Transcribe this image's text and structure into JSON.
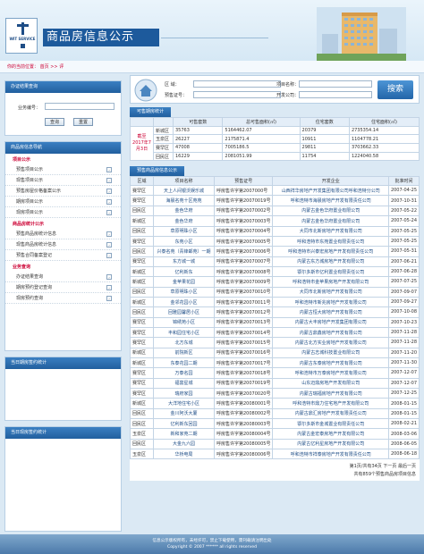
{
  "header": {
    "title": "商品房信息公示",
    "logo_text": "WIT SERVICE"
  },
  "breadcrumb": {
    "prefix": "你的当前位置：",
    "home": "首页",
    "sep1": ">>",
    "current": "评"
  },
  "left": {
    "cert_query": {
      "title": "办证结果查询",
      "label": "业务编号：",
      "query_btn": "查询",
      "reset_btn": "重置"
    },
    "info_nav": {
      "title": "商品房信息导航",
      "sections": [
        {
          "name": "项目公示",
          "items": [
            "预售项目公示",
            "现售项目公示",
            "预售房屋价格备案公示",
            "期房项目公示",
            "现房项目公示"
          ]
        },
        {
          "name": "商品房统计公示",
          "items": [
            "预售商品房统计信息",
            "现售商品房统计信息",
            "预售合同备案登记"
          ]
        },
        {
          "name": "业务查询",
          "items": [
            "办证结果查询",
            "期房预约登记查询",
            "现房预约查询"
          ]
        }
      ]
    },
    "today_contract": {
      "title": "当日期房签约统计"
    },
    "today_current": {
      "title": "当日现房签约统计"
    }
  },
  "search": {
    "district_label": "区   域：",
    "project_label": "项目名称：",
    "permit_label": "预售证号：",
    "developer_label": "开发公司：",
    "button": "搜索"
  },
  "stats": {
    "tab": "可售期房统计",
    "date_label": "截至2017年7月3日",
    "headers": [
      "",
      "可售套数",
      "总可售面积(㎡)",
      "住宅套数",
      "住宅面积(㎡)"
    ],
    "rows": [
      [
        "新城区",
        "35763",
        "5164462.07",
        "20379",
        "2735354.14"
      ],
      [
        "玉泉区",
        "26227",
        "2175871.4",
        "10911",
        "1104778.21"
      ],
      [
        "赛罕区",
        "47008",
        "7005186.5",
        "29811",
        "3703662.33"
      ],
      [
        "回民区",
        "16229",
        "2081051.99",
        "11754",
        "1224040.58"
      ]
    ]
  },
  "presale": {
    "tab": "预售商品房信息公示",
    "headers": [
      "区域",
      "项目名称",
      "预售证号",
      "开发企业",
      "批准时间"
    ],
    "rows": [
      [
        "赛罕区",
        "天上人间银沃娱乐城",
        "呼房售许字第2007000号",
        "山西祥华房地产开发集团有限公司呼和浩特分公司",
        "2007-04-25"
      ],
      [
        "赛罕区",
        "海晨名苑十区苑苑",
        "呼房售许字第20070019号",
        "呼和浩特市海晨房地产开发有限责任公司",
        "2007-10-31"
      ],
      [
        "回民区",
        "金色华府",
        "呼房售许字第20070002号",
        "内蒙古金色华府置业有限公司",
        "2007-05-22"
      ],
      [
        "新城区",
        "金色华府",
        "呼房售许字第20070003号",
        "内蒙古金色华府置业有限公司",
        "2007-05-24"
      ],
      [
        "回民区",
        "草原明珠小区",
        "呼房售许字第20070004号",
        "大同市北新房地产开发有限公司",
        "2007-05-25"
      ],
      [
        "赛罕区",
        "东苑小区",
        "呼房售许字第20070005号",
        "呼和浩特市东苑置业有限责任公司",
        "2007-05-25"
      ],
      [
        "回民区",
        "兴泰名苑（青锋邮苑）一期",
        "呼房售许字第20070006号",
        "呼和浩特市兴泰宏房地产开发有限责任公司",
        "2007-05-31"
      ],
      [
        "赛罕区",
        "东方城一城",
        "呼房售许字第20070007号",
        "内蒙古东方城房地产开发有限公司",
        "2007-06-21"
      ],
      [
        "新城区",
        "亿利新东",
        "呼房售许字第20070008号",
        "鄂尔多斯市亿利置业有限责任公司",
        "2007-06-28"
      ],
      [
        "新城区",
        "金苹果花园",
        "呼房售许字第20070009号",
        "呼和浩特市金苹果房地产开发有限公司",
        "2007-07-25"
      ],
      [
        "回民区",
        "草原明珠小区",
        "呼房售许字第20070010号",
        "大同市北新房地产开发有限公司",
        "2007-09-07"
      ],
      [
        "新城区",
        "金邻花园小区",
        "呼房售许字第20070011号",
        "呼和浩特市新兆房地产开发有限公司",
        "2007-09-27"
      ],
      [
        "回民区",
        "回雅园馨居小区",
        "呼房售许字第20070012号",
        "内蒙古恒大房地产开发有限公司",
        "2007-10-08"
      ],
      [
        "赛罕区",
        "锦绣苑小区",
        "呼房售许字第20070013号",
        "内蒙古大丰房地产开发集团有限公司",
        "2007-10-23"
      ],
      [
        "赛罕区",
        "丰和园住宅小区",
        "呼房售许字第20070014号",
        "内蒙古鼎鑫房地产开发有限公司",
        "2007-11-28"
      ],
      [
        "赛罕区",
        "北方东城",
        "呼房售许字第20070015号",
        "内蒙古北方实业房地产开发有限公司",
        "2007-11-28"
      ],
      [
        "新城区",
        "前院新区",
        "呼房售许字第20070016号",
        "内蒙古志城科技置业有限公司",
        "2007-11-20"
      ],
      [
        "新城区",
        "东泰花园二期",
        "呼房售许字第20070017号",
        "内蒙古东泰房地产开发有限公司",
        "2007-11-30"
      ],
      [
        "赛罕区",
        "万泰名园",
        "呼房售许字第20070018号",
        "呼和浩特市万泰房地产开发有限公司",
        "2007-12-07"
      ],
      [
        "赛罕区",
        "福富星城",
        "呼房售许字第20070019号",
        "山东迈鼎房地产开发有限公司",
        "2007-12-07"
      ],
      [
        "赛罕区",
        "瑞府家园",
        "呼房售许字第20070020号",
        "内蒙古瑞福房地产开发有限公司",
        "2007-12-25"
      ],
      [
        "新城区",
        "大洋地住宅小区",
        "呼房售许字第20080001号",
        "呼和浩特市鼎力住宅地产开发有限公司",
        "2008-01-15"
      ],
      [
        "回民区",
        "金川阿沃大厦",
        "呼房售许字第20080002号",
        "内蒙古鼎汇房地产开发有限责任公司",
        "2008-01-15"
      ],
      [
        "回民区",
        "亿利新东回园",
        "呼房售许字第20080003号",
        "鄂尔多斯市金城置业有限责任公司",
        "2008-02-21"
      ],
      [
        "玉泉区",
        "新和家苑二期",
        "呼房售许字第20080004号",
        "内蒙古金宏泰房地产开发有限公司",
        "2008-03-06"
      ],
      [
        "回民区",
        "大金九六园",
        "呼房售许字第20080005号",
        "内蒙古亿利星房地产开发有限公司",
        "2008-06-05"
      ],
      [
        "玉泉区",
        "华桥电局",
        "呼房售许字第20080006号",
        "呼和浩特市祥泰房地产开发有限责任公司",
        "2008-06-18"
      ]
    ],
    "pager": "第1页/共有34页   下一页  最后一页",
    "total": "共有859个预售商品房项目信息"
  },
  "footer": {
    "line1": "信息公示版权所有，未经许可，禁止下载使用，需刊载请注明出处",
    "line2": "Copyright © 2007 ****** all rights reserved"
  }
}
